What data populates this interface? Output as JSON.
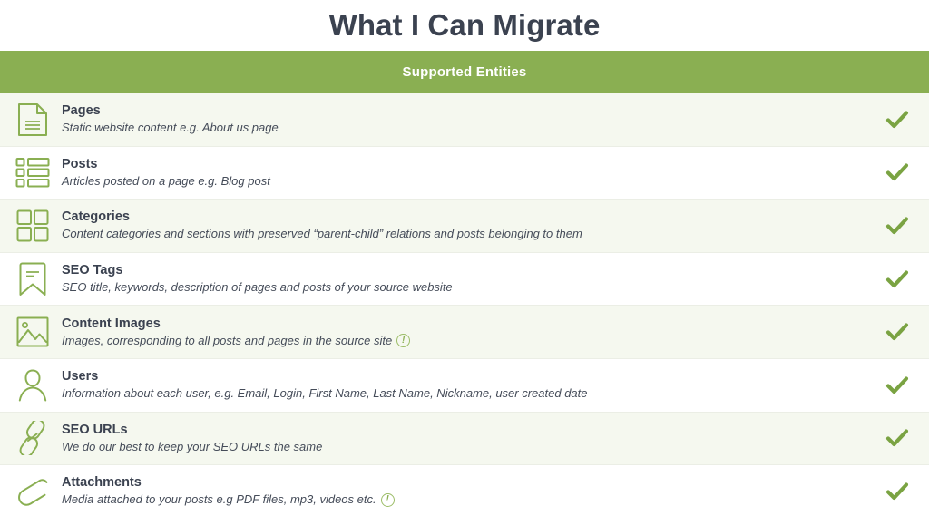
{
  "page": {
    "title": "What I Can Migrate",
    "section_header": "Supported Entities",
    "accent_color": "#8aaf52",
    "check_color": "#7aa342",
    "row_alt_color": "#f5f8ef",
    "title_color": "#3b4250"
  },
  "entities": [
    {
      "icon": "document-icon",
      "name": "Pages",
      "description": "Static website content e.g. About us page",
      "info": null,
      "supported": "✔"
    },
    {
      "icon": "list-icon",
      "name": "Posts",
      "description": "Articles posted on a page e.g. Blog post",
      "info": null,
      "supported": "✔"
    },
    {
      "icon": "grid-icon",
      "name": "Categories",
      "description": "Content categories and sections with preserved “parent-child” relations and posts belonging to them",
      "info": null,
      "supported": "✔"
    },
    {
      "icon": "bookmark-icon",
      "name": "SEO Tags",
      "description": "SEO title, keywords, description of pages and posts of your source website",
      "info": null,
      "supported": "✔"
    },
    {
      "icon": "image-icon",
      "name": "Content Images",
      "description": "Images, corresponding to all posts and pages in the source site",
      "info": "!",
      "supported": "✔"
    },
    {
      "icon": "user-icon",
      "name": "Users",
      "description": "Information about each user, e.g. Email, Login, First Name, Last Name, Nickname, user created date",
      "info": null,
      "supported": "✔"
    },
    {
      "icon": "link-icon",
      "name": "SEO URLs",
      "description": "We do our best to keep your SEO URLs the same",
      "info": null,
      "supported": "✔"
    },
    {
      "icon": "paperclip-icon",
      "name": "Attachments",
      "description": "Media attached to your posts e.g PDF files, mp3, videos etc.",
      "info": "!",
      "supported": "✔"
    }
  ]
}
